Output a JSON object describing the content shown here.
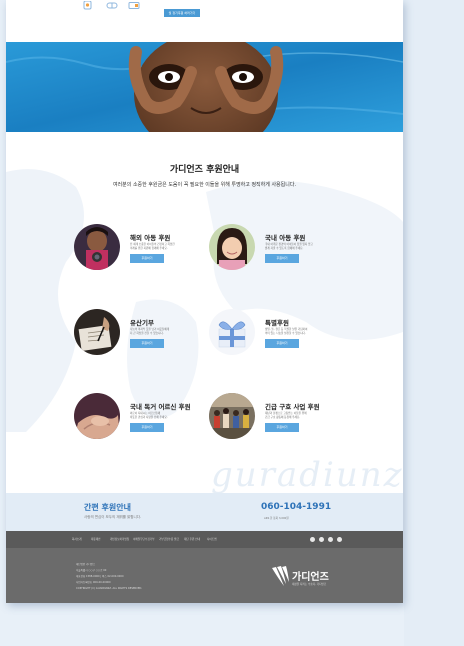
{
  "top": {
    "icons": [
      "badge-icon",
      "pill-icon",
      "card-icon"
    ],
    "button_label": "월 정기후원 하러가기"
  },
  "support": {
    "title": "가디언즈 후원안내",
    "subtitle": "여러분의 소중한 후원금은 도움이 꼭 필요한 이들을 위해 투명하고 정직하게 사용됩니다.",
    "watermark": "guradiunz",
    "cards": [
      {
        "title": "해외 아동 후원",
        "desc": "전 세계 소중한 아이들의 건강하고 희망찬\n미래를 위한 지원에 함께해 주세요.",
        "button": "후원하기"
      },
      {
        "title": "국내 아동 후원",
        "desc": "국내 어려운 환경의 아이들이 꿈을 잃지 않고\n밝게 자랄 수 있도록 함께해 주세요.",
        "button": "후원하기"
      },
      {
        "title": "유산기부",
        "desc": "나눔의 마지막 뜻을 남겨 이웃들에게\n더 큰 희망을 전할 수 있습니다.",
        "button": "후원하기"
      },
      {
        "title": "특별후원",
        "desc": "생일, 돌, 결혼 등 특별한 날을 기념하여\n의미 있는 나눔을 실천할 수 있습니다.",
        "button": "후원하기"
      },
      {
        "title": "국내 독거 어르신 후원",
        "desc": "외로이 지내시는 어르신들께\n따뜻한 관심과 사랑을 전해 주세요.",
        "button": "후원하기"
      },
      {
        "title": "긴급 구호 사업 후원",
        "desc": "재난과 분쟁으로 고통받는 이들을 위해\n긴급 구호 활동에 동참해 주세요.",
        "button": "후원하기"
      }
    ]
  },
  "quick": {
    "title": "간편 후원안내",
    "subtitle": "사랑의 편심이 모두의 재뭐를 밝힙니다.",
    "phone": "060-104-1991",
    "hours": "ARS 한 통화 3,000원"
  },
  "footer": {
    "nav": [
      "회사소개",
      "제휴제안",
      "개인정보처리방침",
      "이메일무단수집거부",
      "기부금영수증 발급",
      "재단 후원 안내",
      "사이트맵"
    ],
    "social_icons": [
      "facebook-icon",
      "instagram-icon",
      "twitter-icon",
      "youtube-icon"
    ],
    "info": [
      "재단법인 가디언즈",
      "서울특별시 ○○구 ○○로 00",
      "대표전화 1588-0000 | 팩스 02-000-0000",
      "사업자등록번호 000-00-00000",
      "COPYRIGHT (C) GUARDIANZ. ALL RIGHTS RESERVED."
    ],
    "logo_text": "가디언즈",
    "logo_sub": "세상을 지키는 수호자, 가디언즈"
  },
  "colors": {
    "accent": "#2e73b8",
    "button": "#5aa6df",
    "hero": "#1f8ed0",
    "footer": "#6b6b6b",
    "band": "#e2ecf6"
  }
}
